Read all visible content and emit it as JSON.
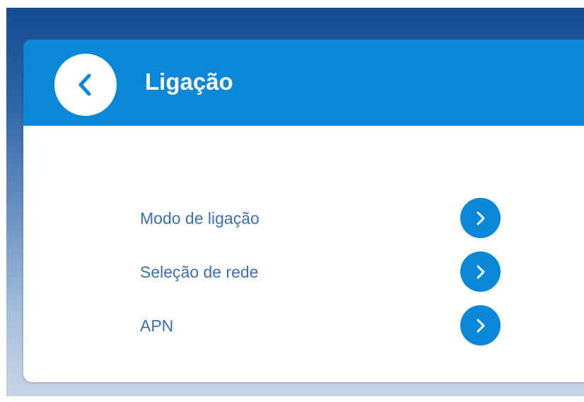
{
  "header": {
    "title": "Ligação",
    "back_icon": "chevron-left-icon"
  },
  "menu": {
    "items": [
      {
        "label": "Modo de ligação",
        "icon": "chevron-right-icon"
      },
      {
        "label": "Seleção de rede",
        "icon": "chevron-right-icon"
      },
      {
        "label": "APN",
        "icon": "chevron-right-icon"
      }
    ]
  },
  "colors": {
    "header_blue": "#0a87d6",
    "label_blue": "#3b6fae",
    "background_top": "#144c92",
    "background_bottom": "#c5d4e6"
  }
}
